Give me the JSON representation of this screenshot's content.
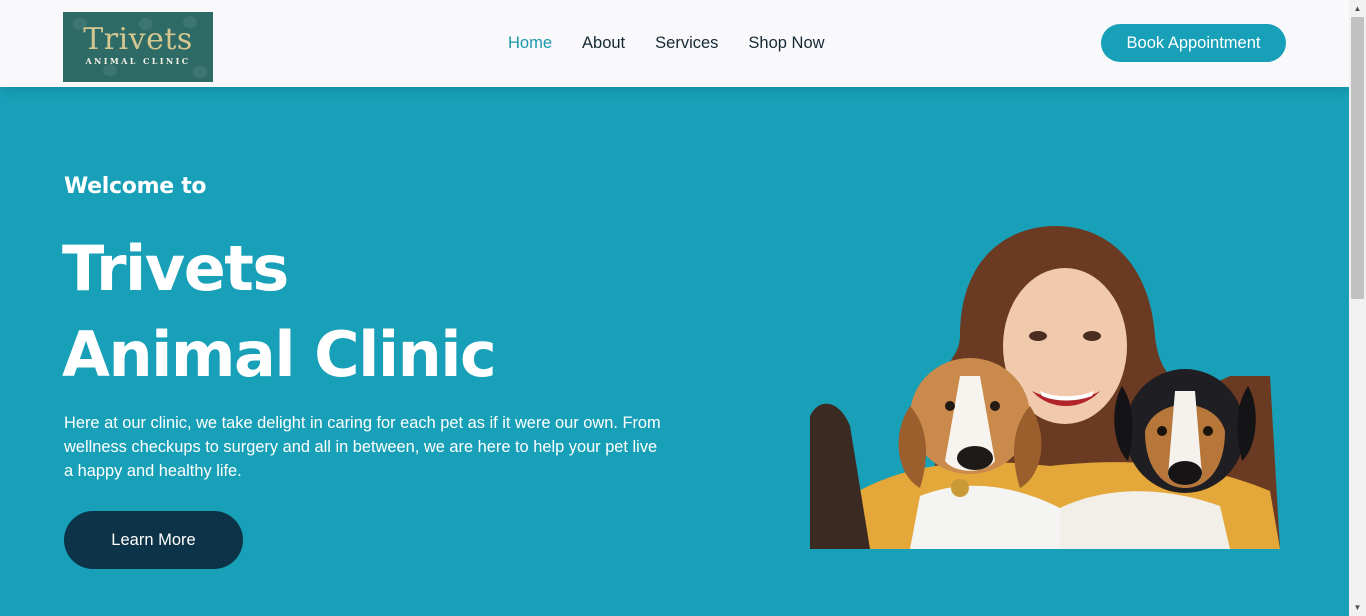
{
  "header": {
    "logo": {
      "title": "Trivets",
      "subtitle": "ANIMAL CLINIC"
    },
    "nav": [
      {
        "label": "Home",
        "active": true
      },
      {
        "label": "About",
        "active": false
      },
      {
        "label": "Services",
        "active": false
      },
      {
        "label": "Shop Now",
        "active": false
      }
    ],
    "cta_label": "Book Appointment"
  },
  "hero": {
    "eyebrow": "Welcome to",
    "title": "Trivets Animal Clinic",
    "description": "Here at our clinic, we take delight in caring for each pet as if it were our own. From wellness checkups to surgery and all in between, we are here to help your pet live a happy and healthy life.",
    "button_label": "Learn More",
    "image_icon": "woman-with-two-beagles-photo"
  },
  "colors": {
    "brand": "#17a0b7",
    "dark": "#0c3347",
    "nav_text": "#152836",
    "header_bg": "#f9f9fb"
  }
}
